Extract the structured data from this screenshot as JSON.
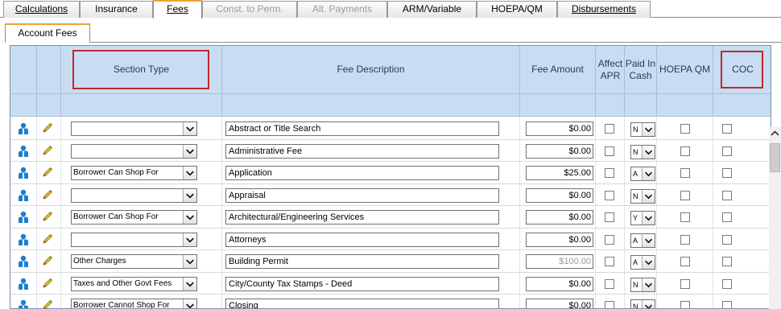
{
  "tabs": [
    {
      "label": "Calculations",
      "state": "link"
    },
    {
      "label": "Insurance",
      "state": "normal"
    },
    {
      "label": "Fees",
      "state": "active"
    },
    {
      "label": "Const. to Perm.",
      "state": "disabled"
    },
    {
      "label": "Alt. Payments",
      "state": "disabled"
    },
    {
      "label": "ARM/Variable",
      "state": "normal"
    },
    {
      "label": "HOEPA/QM",
      "state": "normal"
    },
    {
      "label": "Disbursements",
      "state": "link"
    }
  ],
  "subtab": {
    "label": "Account Fees"
  },
  "columns": {
    "section_type": "Section Type",
    "fee_description": "Fee Description",
    "fee_amount": "Fee Amount",
    "affect_apr": "Affect APR",
    "paid_in_cash": "Paid In Cash",
    "hoepa_qm": "HOEPA QM",
    "coc": "COC"
  },
  "rows": [
    {
      "section_type": "",
      "fee_description": "Abstract or Title Search",
      "fee_amount": "$0.00",
      "amount_muted": false,
      "paid_in_cash": "N"
    },
    {
      "section_type": "",
      "fee_description": "Administrative Fee",
      "fee_amount": "$0.00",
      "amount_muted": false,
      "paid_in_cash": "N"
    },
    {
      "section_type": "Borrower Can Shop For",
      "fee_description": "Application",
      "fee_amount": "$25.00",
      "amount_muted": false,
      "paid_in_cash": "A"
    },
    {
      "section_type": "",
      "fee_description": "Appraisal",
      "fee_amount": "$0.00",
      "amount_muted": false,
      "paid_in_cash": "N"
    },
    {
      "section_type": "Borrower Can Shop For",
      "fee_description": "Architectural/Engineering Services",
      "fee_amount": "$0.00",
      "amount_muted": false,
      "paid_in_cash": "Y"
    },
    {
      "section_type": "",
      "fee_description": "Attorneys",
      "fee_amount": "$0.00",
      "amount_muted": false,
      "paid_in_cash": "A"
    },
    {
      "section_type": "Other Charges",
      "fee_description": "Building Permit",
      "fee_amount": "$100.00",
      "amount_muted": true,
      "paid_in_cash": "A"
    },
    {
      "section_type": "Taxes and Other Govt Fees",
      "fee_description": "City/County Tax Stamps - Deed",
      "fee_amount": "$0.00",
      "amount_muted": false,
      "paid_in_cash": "N"
    },
    {
      "section_type": "Borrower Cannot Shop For",
      "fee_description": "Closing",
      "fee_amount": "$0.00",
      "amount_muted": false,
      "paid_in_cash": "N"
    }
  ],
  "colors": {
    "header_bg": "#c9ddf2",
    "highlight_border": "#c0262d",
    "active_tab_accent": "#f0a030",
    "icon_blue": "#1b7fd1"
  },
  "icons": {
    "row_person": "person-icon",
    "row_edit": "pencil-icon",
    "dropdown": "chevron-down-icon",
    "scroll_up": "chevron-up-icon"
  }
}
